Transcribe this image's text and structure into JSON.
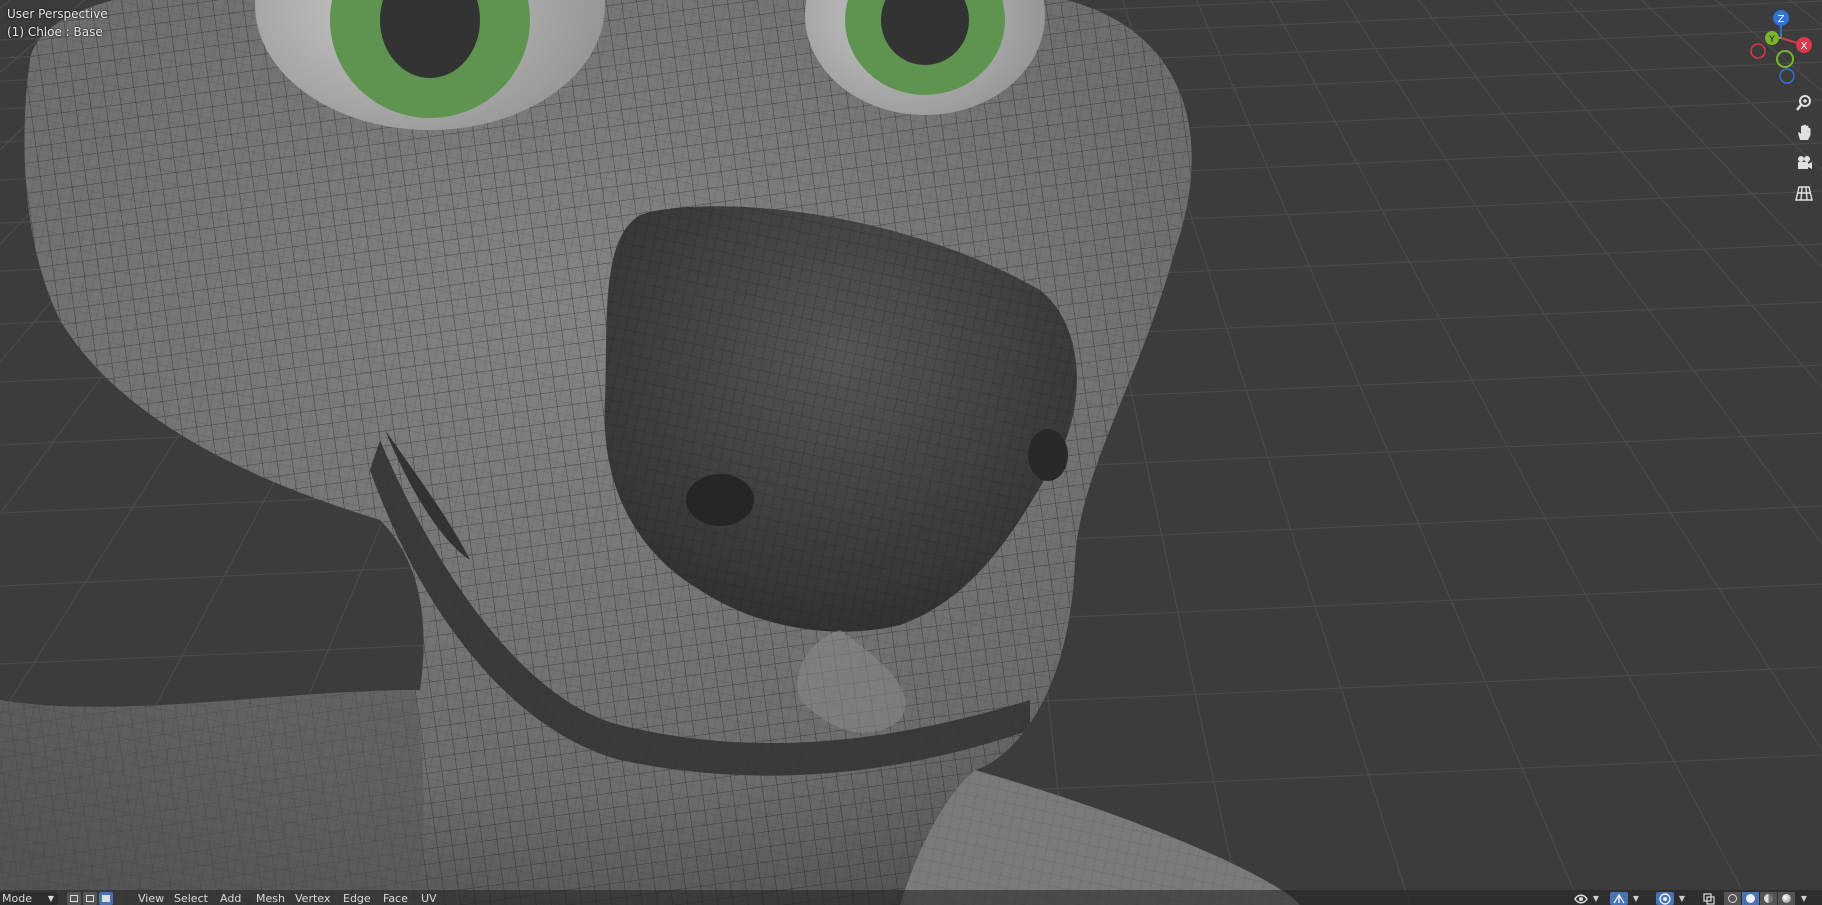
{
  "viewport": {
    "view_name": "User Perspective",
    "object_info": "(1) Chloe : Base",
    "colors": {
      "background": "#3c3c3c",
      "grid": "#4a4a4a",
      "mesh": "#707070",
      "wire": "#1d1d1d",
      "iris": "#5e9450",
      "pupil": "#333333",
      "eye": "#b4b4b4"
    }
  },
  "gizmo": {
    "axes": [
      {
        "label": "Z",
        "color": "#2f72d8"
      },
      {
        "label": "X",
        "color": "#d9374a"
      },
      {
        "label": "Y",
        "color": "#79b52c"
      }
    ]
  },
  "nav_buttons": [
    {
      "name": "zoom",
      "icon": "zoom-icon"
    },
    {
      "name": "pan",
      "icon": "hand-icon"
    },
    {
      "name": "camera",
      "icon": "camera-icon"
    },
    {
      "name": "ortho",
      "icon": "grid-icon"
    }
  ],
  "header": {
    "mode_label": "Mode",
    "menus": [
      "View",
      "Select",
      "Add",
      "Mesh",
      "Vertex",
      "Edge",
      "Face",
      "UV"
    ],
    "select_modes": [
      "vertex-select-icon",
      "edge-select-icon",
      "face-select-icon"
    ],
    "right_icons": [
      "visibility-icon",
      "gizmo-icon",
      "overlay-icon",
      "xray-icon"
    ],
    "shading": [
      "wireframe-shading-icon",
      "solid-shading-icon",
      "material-shading-icon",
      "rendered-shading-icon"
    ],
    "active_select_mode": 2,
    "active_shading": 1
  }
}
